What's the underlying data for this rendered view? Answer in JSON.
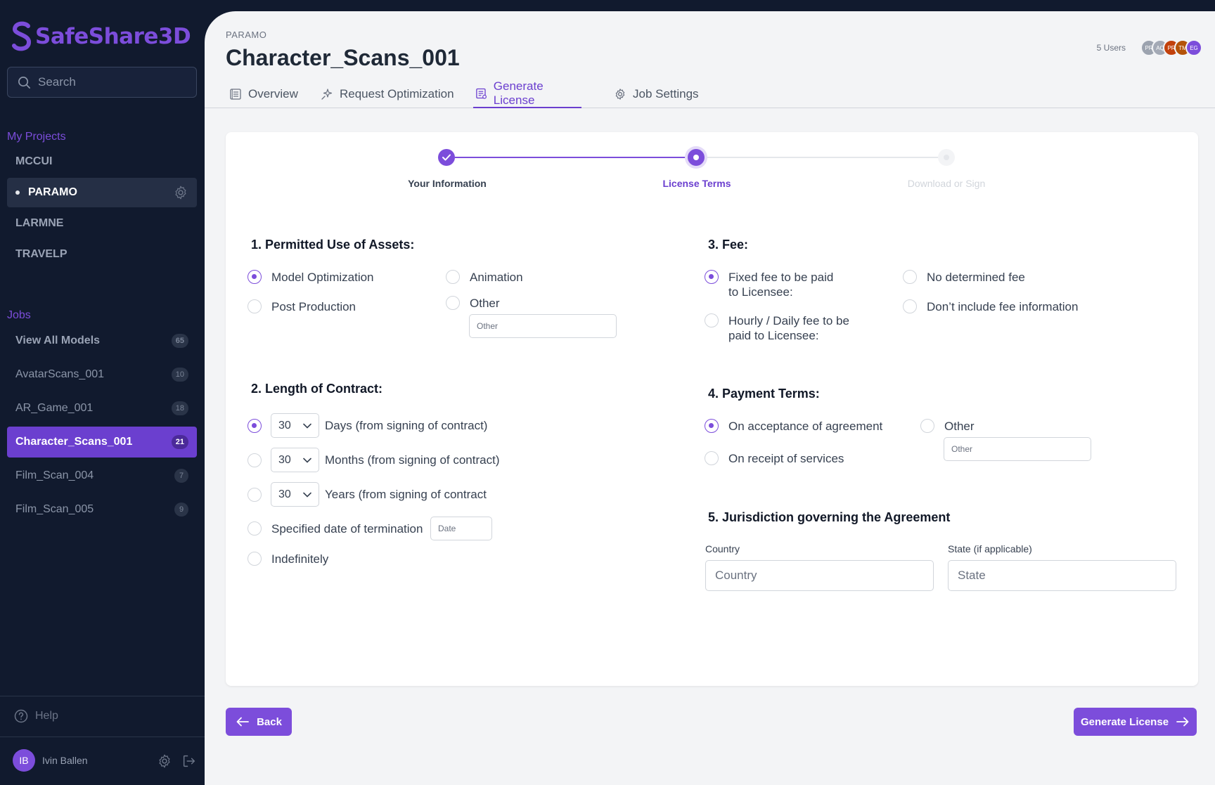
{
  "app": {
    "name": "SafeShare3D"
  },
  "search": {
    "placeholder": "Search"
  },
  "sidebar": {
    "projects_title": "My Projects",
    "projects": [
      {
        "label": "MCCUI"
      },
      {
        "label": "PARAMO",
        "active": true
      },
      {
        "label": "LARMNE"
      },
      {
        "label": "TRAVELP"
      }
    ],
    "jobs_title": "Jobs",
    "jobs": [
      {
        "label": "View All Models",
        "count": "65"
      },
      {
        "label": "AvatarScans_001",
        "count": "10"
      },
      {
        "label": "AR_Game_001",
        "count": "18"
      },
      {
        "label": "Character_Scans_001",
        "count": "21",
        "active": true
      },
      {
        "label": "Film_Scan_004",
        "count": "7"
      },
      {
        "label": "Film_Scan_005",
        "count": "9"
      }
    ],
    "help": "Help",
    "user": {
      "initials": "IB",
      "name": "Ivin Ballen"
    }
  },
  "header": {
    "breadcrumb": "PARAMO",
    "title": "Character_Scans_001",
    "users_label": "5 Users",
    "avatars": [
      {
        "initials": "PR",
        "color": "#9ca3af"
      },
      {
        "initials": "AQ",
        "color": "#a3a9b5"
      },
      {
        "initials": "PR",
        "color": "#c2410c"
      },
      {
        "initials": "TM",
        "color": "#b45309"
      },
      {
        "initials": "EG",
        "color": "#7c4ddb"
      }
    ]
  },
  "tabs": [
    {
      "label": "Overview",
      "icon": "document-list-icon"
    },
    {
      "label": "Request Optimization",
      "icon": "sparkle-icon"
    },
    {
      "label": "Generate License",
      "icon": "license-icon",
      "active": true
    },
    {
      "label": "Job Settings",
      "icon": "gear-icon"
    }
  ],
  "stepper": {
    "steps": [
      {
        "label": "Your Information",
        "state": "complete"
      },
      {
        "label": "License Terms",
        "state": "current"
      },
      {
        "label": "Download or Sign",
        "state": "upcoming"
      }
    ]
  },
  "form": {
    "q1": {
      "title": "1. Permitted Use of Assets:",
      "options": [
        "Model Optimization",
        "Animation",
        "Post Production",
        "Other"
      ],
      "selected": "Model Optimization",
      "other_placeholder": "Other"
    },
    "q2": {
      "title": "2. Length of Contract:",
      "days_value": "30",
      "days_label": "Days (from signing of contract)",
      "months_value": "30",
      "months_label": "Months (from signing of contract)",
      "years_value": "30",
      "years_label": "Years (from signing of contract",
      "date_label": "Specified date of termination",
      "date_placeholder": "Date",
      "indefinitely_label": "Indefinitely",
      "selected": "days"
    },
    "q3": {
      "title": "3. Fee:",
      "fixed_line1": "Fixed fee to be paid",
      "fixed_line2": "to Licensee:",
      "no_fee": "No determined fee",
      "hourly_line1": "Hourly / Daily fee to be",
      "hourly_line2": "paid to Licensee:",
      "dont_include": "Don’t include fee information",
      "selected": "fixed"
    },
    "q4": {
      "title": "4. Payment Terms:",
      "acceptance": "On acceptance of agreement",
      "other": "Other",
      "other_placeholder": "Other",
      "receipt": "On receipt of services",
      "selected": "acceptance"
    },
    "q5": {
      "title": "5. Jurisdiction governing the Agreement",
      "country_label": "Country",
      "country_placeholder": "Country",
      "state_label": "State (if applicable)",
      "state_placeholder": "State"
    }
  },
  "actions": {
    "back": "Back",
    "generate": "Generate License"
  },
  "colors": {
    "accent": "#7c4ddb",
    "sidebar_bg": "#111a2e",
    "main_bg": "#f3f4f6"
  }
}
